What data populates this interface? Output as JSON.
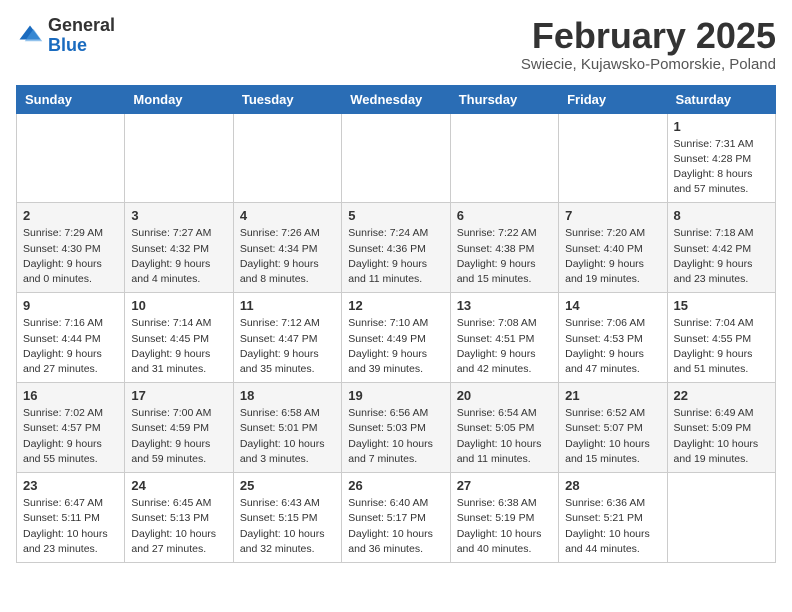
{
  "logo": {
    "general": "General",
    "blue": "Blue"
  },
  "header": {
    "month": "February 2025",
    "location": "Swiecie, Kujawsko-Pomorskie, Poland"
  },
  "weekdays": [
    "Sunday",
    "Monday",
    "Tuesday",
    "Wednesday",
    "Thursday",
    "Friday",
    "Saturday"
  ],
  "weeks": [
    [
      {
        "day": "",
        "info": ""
      },
      {
        "day": "",
        "info": ""
      },
      {
        "day": "",
        "info": ""
      },
      {
        "day": "",
        "info": ""
      },
      {
        "day": "",
        "info": ""
      },
      {
        "day": "",
        "info": ""
      },
      {
        "day": "1",
        "info": "Sunrise: 7:31 AM\nSunset: 4:28 PM\nDaylight: 8 hours and 57 minutes."
      }
    ],
    [
      {
        "day": "2",
        "info": "Sunrise: 7:29 AM\nSunset: 4:30 PM\nDaylight: 9 hours and 0 minutes."
      },
      {
        "day": "3",
        "info": "Sunrise: 7:27 AM\nSunset: 4:32 PM\nDaylight: 9 hours and 4 minutes."
      },
      {
        "day": "4",
        "info": "Sunrise: 7:26 AM\nSunset: 4:34 PM\nDaylight: 9 hours and 8 minutes."
      },
      {
        "day": "5",
        "info": "Sunrise: 7:24 AM\nSunset: 4:36 PM\nDaylight: 9 hours and 11 minutes."
      },
      {
        "day": "6",
        "info": "Sunrise: 7:22 AM\nSunset: 4:38 PM\nDaylight: 9 hours and 15 minutes."
      },
      {
        "day": "7",
        "info": "Sunrise: 7:20 AM\nSunset: 4:40 PM\nDaylight: 9 hours and 19 minutes."
      },
      {
        "day": "8",
        "info": "Sunrise: 7:18 AM\nSunset: 4:42 PM\nDaylight: 9 hours and 23 minutes."
      }
    ],
    [
      {
        "day": "9",
        "info": "Sunrise: 7:16 AM\nSunset: 4:44 PM\nDaylight: 9 hours and 27 minutes."
      },
      {
        "day": "10",
        "info": "Sunrise: 7:14 AM\nSunset: 4:45 PM\nDaylight: 9 hours and 31 minutes."
      },
      {
        "day": "11",
        "info": "Sunrise: 7:12 AM\nSunset: 4:47 PM\nDaylight: 9 hours and 35 minutes."
      },
      {
        "day": "12",
        "info": "Sunrise: 7:10 AM\nSunset: 4:49 PM\nDaylight: 9 hours and 39 minutes."
      },
      {
        "day": "13",
        "info": "Sunrise: 7:08 AM\nSunset: 4:51 PM\nDaylight: 9 hours and 42 minutes."
      },
      {
        "day": "14",
        "info": "Sunrise: 7:06 AM\nSunset: 4:53 PM\nDaylight: 9 hours and 47 minutes."
      },
      {
        "day": "15",
        "info": "Sunrise: 7:04 AM\nSunset: 4:55 PM\nDaylight: 9 hours and 51 minutes."
      }
    ],
    [
      {
        "day": "16",
        "info": "Sunrise: 7:02 AM\nSunset: 4:57 PM\nDaylight: 9 hours and 55 minutes."
      },
      {
        "day": "17",
        "info": "Sunrise: 7:00 AM\nSunset: 4:59 PM\nDaylight: 9 hours and 59 minutes."
      },
      {
        "day": "18",
        "info": "Sunrise: 6:58 AM\nSunset: 5:01 PM\nDaylight: 10 hours and 3 minutes."
      },
      {
        "day": "19",
        "info": "Sunrise: 6:56 AM\nSunset: 5:03 PM\nDaylight: 10 hours and 7 minutes."
      },
      {
        "day": "20",
        "info": "Sunrise: 6:54 AM\nSunset: 5:05 PM\nDaylight: 10 hours and 11 minutes."
      },
      {
        "day": "21",
        "info": "Sunrise: 6:52 AM\nSunset: 5:07 PM\nDaylight: 10 hours and 15 minutes."
      },
      {
        "day": "22",
        "info": "Sunrise: 6:49 AM\nSunset: 5:09 PM\nDaylight: 10 hours and 19 minutes."
      }
    ],
    [
      {
        "day": "23",
        "info": "Sunrise: 6:47 AM\nSunset: 5:11 PM\nDaylight: 10 hours and 23 minutes."
      },
      {
        "day": "24",
        "info": "Sunrise: 6:45 AM\nSunset: 5:13 PM\nDaylight: 10 hours and 27 minutes."
      },
      {
        "day": "25",
        "info": "Sunrise: 6:43 AM\nSunset: 5:15 PM\nDaylight: 10 hours and 32 minutes."
      },
      {
        "day": "26",
        "info": "Sunrise: 6:40 AM\nSunset: 5:17 PM\nDaylight: 10 hours and 36 minutes."
      },
      {
        "day": "27",
        "info": "Sunrise: 6:38 AM\nSunset: 5:19 PM\nDaylight: 10 hours and 40 minutes."
      },
      {
        "day": "28",
        "info": "Sunrise: 6:36 AM\nSunset: 5:21 PM\nDaylight: 10 hours and 44 minutes."
      },
      {
        "day": "",
        "info": ""
      }
    ]
  ]
}
